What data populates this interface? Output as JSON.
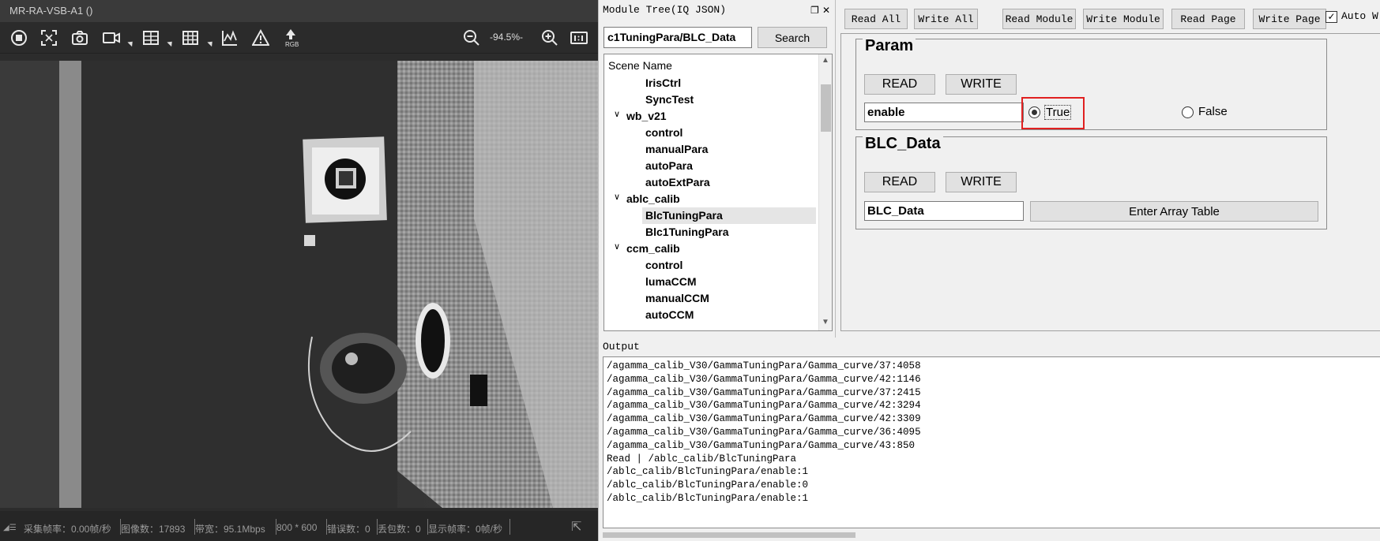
{
  "viewer": {
    "title": "MR-RA-VSB-A1 ()",
    "zoom": "-94.5%-",
    "rgb_label": "RGB",
    "toolbar_icons": [
      "stop-icon",
      "fit-screen-icon",
      "camera-icon",
      "video-icon",
      "grid-icon",
      "grid-3x3-icon",
      "chart-line-icon",
      "warning-icon",
      "rgb-icon",
      "zoom-out-icon",
      "zoom-in-icon",
      "one-to-one-icon"
    ],
    "status": {
      "capture_rate": "采集帧率：0.00帧/秒",
      "image_count": "图像数：17893",
      "bandwidth": "带宽：95.1Mbps",
      "resolution": "800 * 600",
      "error_count": "错误数：0",
      "lost_packets": "丢包数：0",
      "display_rate": "显示帧率：0帧/秒"
    }
  },
  "tree_panel": {
    "title": "Module Tree(IQ JSON)",
    "path_value": "c1TuningPara/BLC_Data",
    "search_label": "Search",
    "header": "Scene Name",
    "items": [
      {
        "label": "IrisCtrl",
        "level": 2
      },
      {
        "label": "SyncTest",
        "level": 2
      },
      {
        "label": "wb_v21",
        "level": 1,
        "expanded": true
      },
      {
        "label": "control",
        "level": 2
      },
      {
        "label": "manualPara",
        "level": 2
      },
      {
        "label": "autoPara",
        "level": 2
      },
      {
        "label": "autoExtPara",
        "level": 2
      },
      {
        "label": "ablc_calib",
        "level": 1,
        "expanded": true
      },
      {
        "label": "BlcTuningPara",
        "level": 2,
        "selected": true
      },
      {
        "label": "Blc1TuningPara",
        "level": 2
      },
      {
        "label": "ccm_calib",
        "level": 1,
        "expanded": true
      },
      {
        "label": "control",
        "level": 2
      },
      {
        "label": "lumaCCM",
        "level": 2
      },
      {
        "label": "manualCCM",
        "level": 2
      },
      {
        "label": "autoCCM",
        "level": 2
      }
    ]
  },
  "param_panel": {
    "buttons": [
      "Read All",
      "Write All",
      "Read Module",
      "Write Module",
      "Read Page",
      "Write Page"
    ],
    "auto_label": "Auto W",
    "auto_checked": true,
    "param_group": {
      "title": "Param",
      "read_label": "READ",
      "write_label": "WRITE",
      "field_value": "enable",
      "true_label": "True",
      "false_label": "False",
      "selected": "True"
    },
    "blc_group": {
      "title": "BLC_Data",
      "read_label": "READ",
      "write_label": "WRITE",
      "field_value": "BLC_Data",
      "array_button": "Enter Array Table"
    }
  },
  "output": {
    "title": "Output",
    "lines": [
      "/agamma_calib_V30/GammaTuningPara/Gamma_curve/37:4058",
      "/agamma_calib_V30/GammaTuningPara/Gamma_curve/42:1146",
      "/agamma_calib_V30/GammaTuningPara/Gamma_curve/37:2415",
      "/agamma_calib_V30/GammaTuningPara/Gamma_curve/42:3294",
      "/agamma_calib_V30/GammaTuningPara/Gamma_curve/42:3309",
      "/agamma_calib_V30/GammaTuningPara/Gamma_curve/36:4095",
      "/agamma_calib_V30/GammaTuningPara/Gamma_curve/43:850",
      "Read | /ablc_calib/BlcTuningPara",
      "/ablc_calib/BlcTuningPara/enable:1",
      "/ablc_calib/BlcTuningPara/enable:0",
      "/ablc_calib/BlcTuningPara/enable:1"
    ]
  },
  "colors": {
    "highlight": "#e02020",
    "viewer_bg": "#2c2c2c",
    "panel_bg": "#f0f0f0"
  }
}
